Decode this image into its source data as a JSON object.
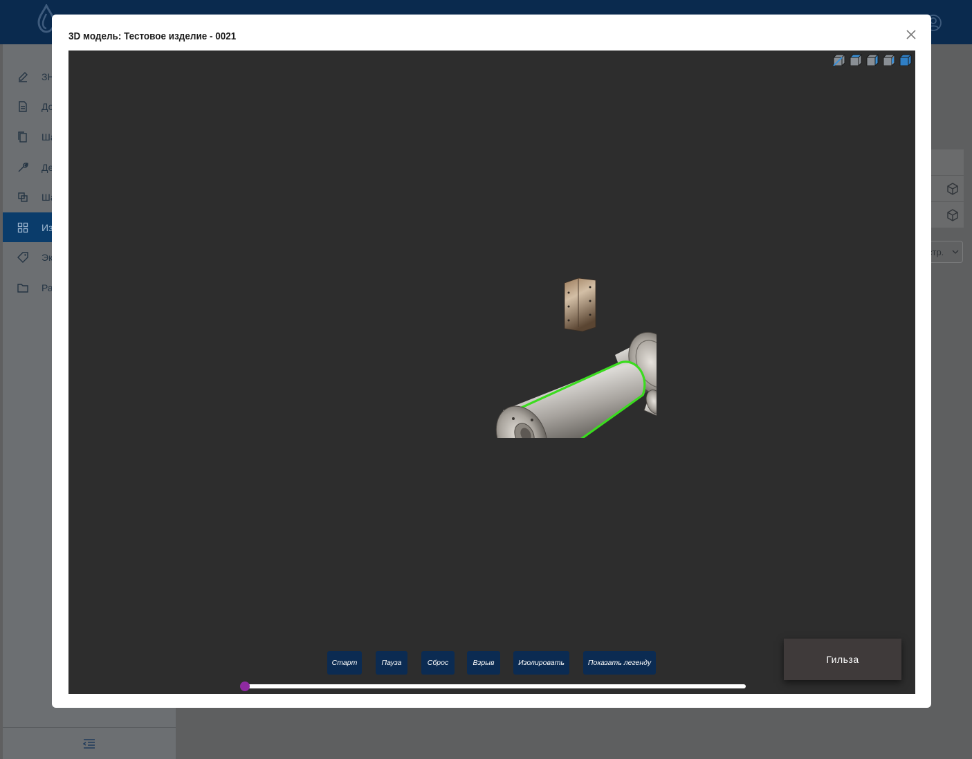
{
  "modal": {
    "title": "3D модель: Тестовое изделие - 0021",
    "close_icon": "close-icon"
  },
  "viewer": {
    "background": "#2d2d2d",
    "highlight_color": "#3bdc1f",
    "view_cubes": [
      {
        "name": "view-cube-1-icon"
      },
      {
        "name": "view-cube-2-icon"
      },
      {
        "name": "view-cube-3-icon"
      },
      {
        "name": "view-cube-4-icon"
      },
      {
        "name": "view-cube-5-icon"
      }
    ],
    "controls": {
      "start": "Старт",
      "pause": "Пауза",
      "reset": "Сброс",
      "explode": "Взрыв",
      "isolate": "Изолировать",
      "show_legend": "Показать легенду"
    },
    "slider": {
      "value": 0,
      "thumb_color": "#8e2aa0"
    },
    "selected_part_label": "Гильза"
  },
  "sidebar": {
    "items": [
      {
        "label": "ЗН",
        "icon": "edit-icon"
      },
      {
        "label": "До",
        "icon": "document-icon"
      },
      {
        "label": "Ша",
        "icon": "copy-icon"
      },
      {
        "label": "Де",
        "icon": "wrench-icon"
      },
      {
        "label": "Ша",
        "icon": "layers-icon"
      },
      {
        "label": "Из",
        "icon": "grid-icon",
        "active": true
      },
      {
        "label": "Эк",
        "icon": "tag-icon"
      },
      {
        "label": "Ра",
        "icon": "folder-icon"
      }
    ],
    "collapse_icon": "collapse-menu-icon"
  },
  "content": {
    "pager_label": "стр.",
    "row_icon": "cube-icon"
  },
  "colors": {
    "topbar": "#0a2a4e",
    "button": "#0b2b52",
    "active_nav": "#0a3c6b"
  }
}
